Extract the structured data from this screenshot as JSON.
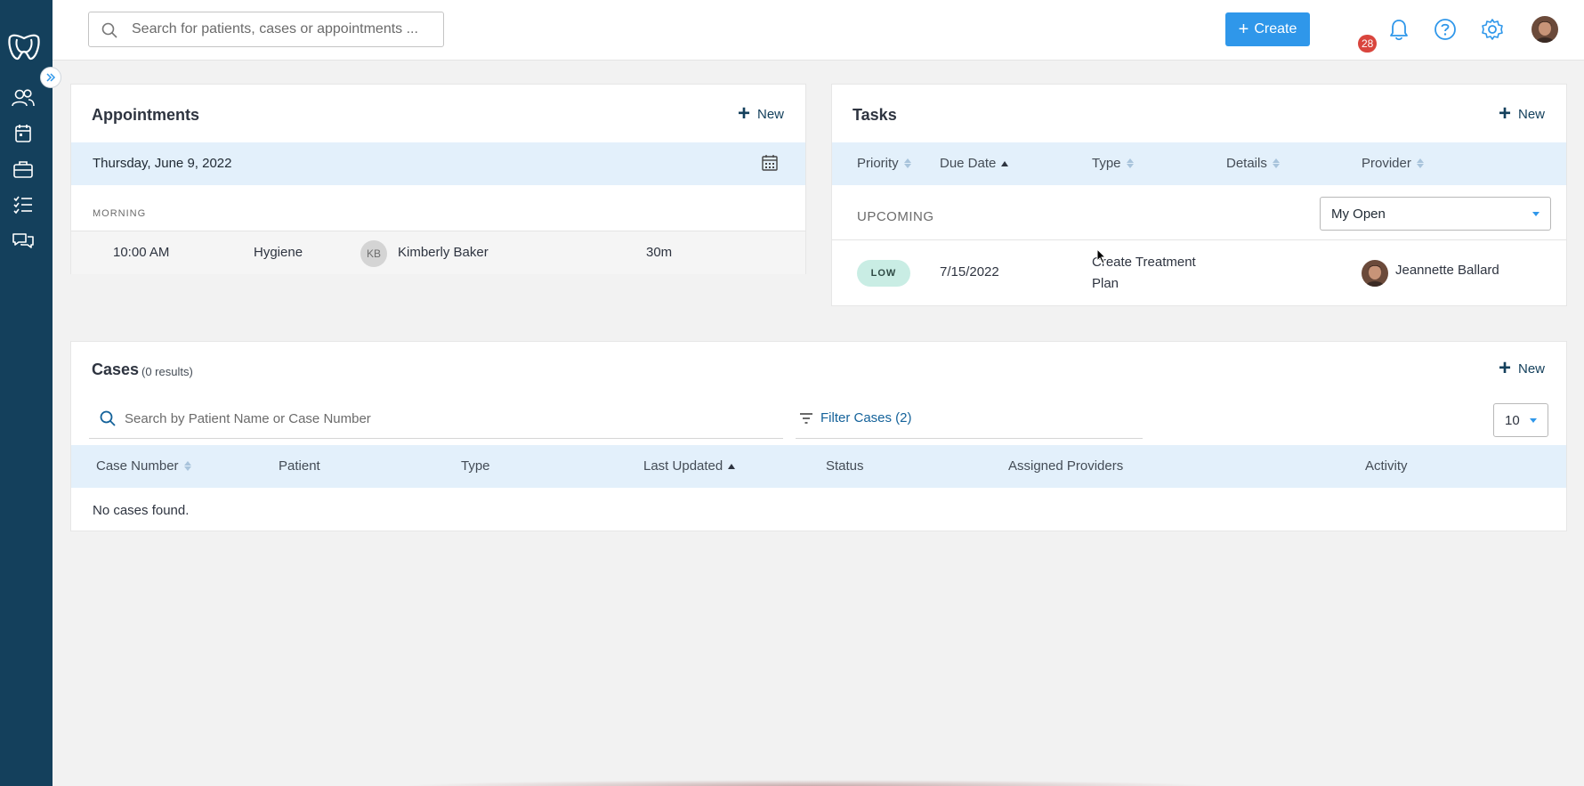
{
  "topbar": {
    "search_placeholder": "Search for patients, cases or appointments ...",
    "create_label": "Create",
    "notification_count": "28",
    "accent_color": "#2f97ea"
  },
  "sidebar": {
    "items": [
      {
        "icon": "users-icon"
      },
      {
        "icon": "calendar-icon"
      },
      {
        "icon": "briefcase-icon"
      },
      {
        "icon": "checklist-icon"
      },
      {
        "icon": "chat-icon"
      }
    ],
    "background": "#14405c"
  },
  "appointments": {
    "title": "Appointments",
    "new_label": "New",
    "date": "Thursday, June 9, 2022",
    "section": "MORNING",
    "rows": [
      {
        "time": "10:00 AM",
        "type": "Hygiene",
        "initials": "KB",
        "patient": "Kimberly Baker",
        "duration": "30m"
      }
    ]
  },
  "tasks": {
    "title": "Tasks",
    "new_label": "New",
    "columns": [
      "Priority",
      "Due Date",
      "Type",
      "Details",
      "Provider"
    ],
    "group_label": "UPCOMING",
    "filter_value": "My Open",
    "rows": [
      {
        "priority": "LOW",
        "due_date": "7/15/2022",
        "type": "Create Treatment Plan",
        "details": "",
        "provider": "Jeannette Ballard"
      }
    ]
  },
  "cases": {
    "title": "Cases",
    "results": "(0 results)",
    "new_label": "New",
    "search_placeholder": "Search by Patient Name or Case Number",
    "filter_label": "Filter Cases (2)",
    "page_size": "10",
    "columns": [
      "Case Number",
      "Patient",
      "Type",
      "Last Updated",
      "Status",
      "Assigned Providers",
      "Activity"
    ],
    "empty_message": "No cases found."
  }
}
